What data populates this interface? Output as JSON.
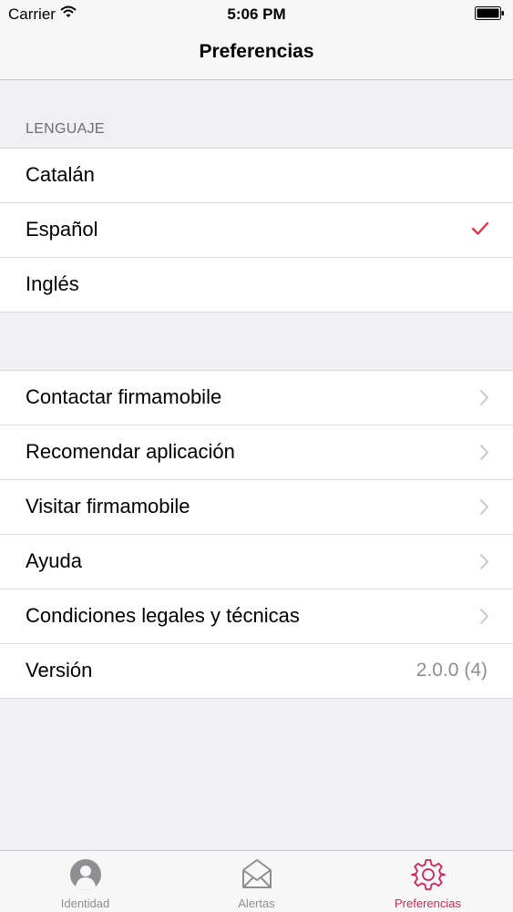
{
  "status_bar": {
    "carrier": "Carrier",
    "time": "5:06 PM"
  },
  "nav": {
    "title": "Preferencias"
  },
  "language_section": {
    "header": "LENGUAJE",
    "items": [
      {
        "label": "Catalán",
        "selected": false
      },
      {
        "label": "Español",
        "selected": true
      },
      {
        "label": "Inglés",
        "selected": false
      }
    ]
  },
  "links_section": {
    "items": [
      {
        "label": "Contactar firmamobile"
      },
      {
        "label": "Recomendar aplicación"
      },
      {
        "label": "Visitar firmamobile"
      },
      {
        "label": "Ayuda"
      },
      {
        "label": "Condiciones legales y técnicas"
      }
    ],
    "version": {
      "label": "Versión",
      "value": "2.0.0 (4)"
    }
  },
  "tabbar": {
    "tabs": [
      {
        "label": "Identidad",
        "icon": "person-icon",
        "active": false
      },
      {
        "label": "Alertas",
        "icon": "envelope-icon",
        "active": false
      },
      {
        "label": "Preferencias",
        "icon": "gear-icon",
        "active": true
      }
    ]
  },
  "colors": {
    "accent": "#d4225a",
    "check": "#e0344a",
    "background": "#efeff4"
  }
}
